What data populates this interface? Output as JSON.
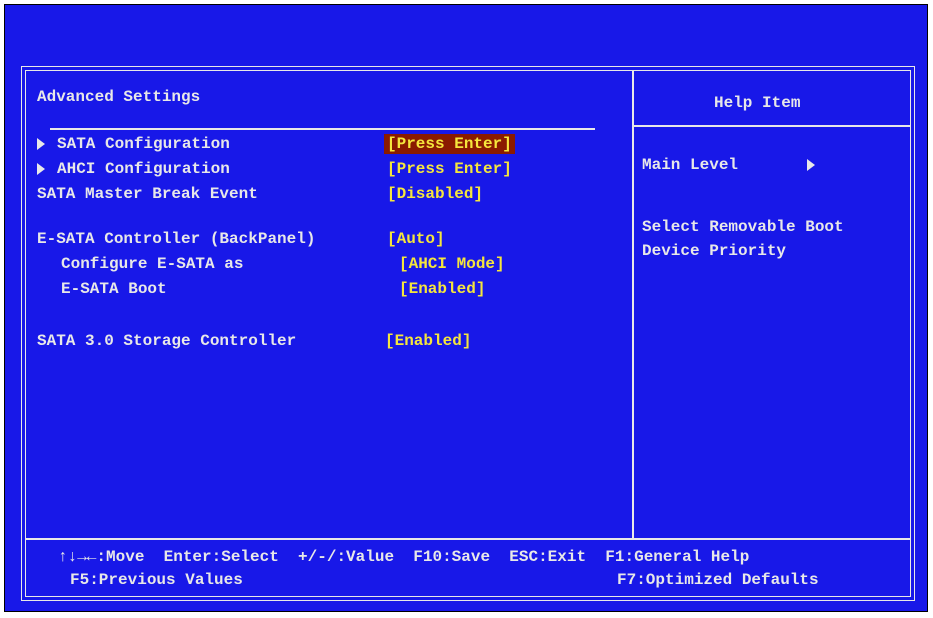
{
  "header": {
    "title": "Advanced Settings"
  },
  "help": {
    "title": "Help Item",
    "level": "Main Level",
    "desc_line1": "Select Removable Boot",
    "desc_line2": "Device Priority"
  },
  "settings": [
    {
      "label": "SATA Configuration",
      "value": "[Press Enter]",
      "submenu": true,
      "selected": true
    },
    {
      "label": "AHCI Configuration",
      "value": "[Press Enter]",
      "submenu": true,
      "selected": false
    },
    {
      "label": "SATA Master Break Event",
      "value": "[Disabled]",
      "submenu": false
    },
    {
      "label": "E-SATA Controller (BackPanel)",
      "value": "[Auto]",
      "submenu": false
    },
    {
      "label": "Configure E-SATA as",
      "value": "[AHCI Mode]",
      "submenu": false,
      "indent": true
    },
    {
      "label": "E-SATA Boot",
      "value": "[Enabled]",
      "submenu": false,
      "indent": true
    },
    {
      "label": "SATA 3.0 Storage Controller",
      "value": "[Enabled]",
      "submenu": false
    }
  ],
  "footer": {
    "line1": "↑↓→←:Move  Enter:Select  +/-/:Value  F10:Save  ESC:Exit  F1:General Help",
    "prev": "F5:Previous Values",
    "optimized": "F7:Optimized Defaults"
  },
  "colors": {
    "background": "#1818e8",
    "text": "#e8e8e8",
    "value": "#f5e63c",
    "highlight": "#8a1a00"
  }
}
